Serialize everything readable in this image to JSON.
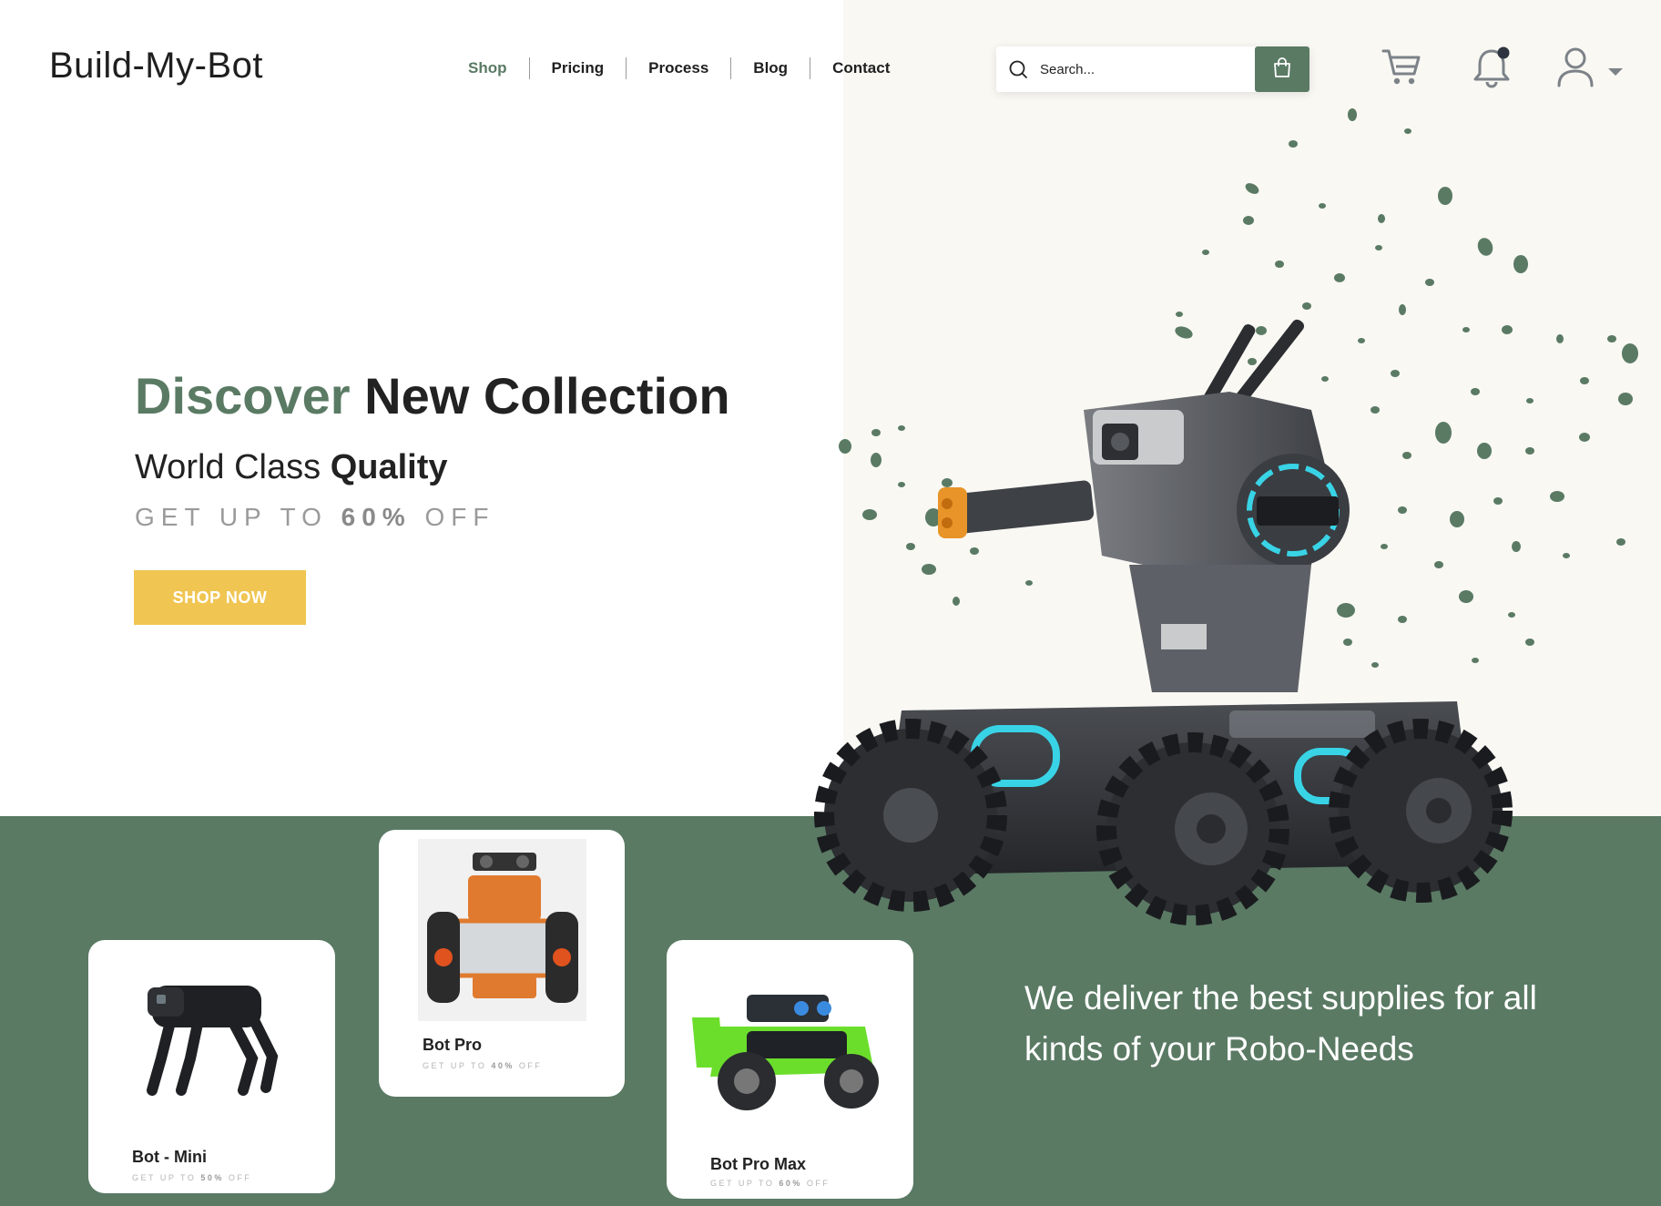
{
  "brand": {
    "logo_text": "Build-My-Bot"
  },
  "nav": {
    "items": [
      {
        "label": "Shop",
        "active": true
      },
      {
        "label": "Pricing"
      },
      {
        "label": "Process"
      },
      {
        "label": "Blog"
      },
      {
        "label": "Contact"
      }
    ]
  },
  "search": {
    "placeholder": "Search..."
  },
  "header_icons": [
    "shopping-bag-icon",
    "cart-icon",
    "bell-icon",
    "user-icon",
    "caret-down-icon"
  ],
  "hero": {
    "title_accent": "Discover",
    "title_rest": "New Collection",
    "subtitle_regular": "World Class",
    "subtitle_bold": "Quality",
    "offer_prefix": "GET UP TO",
    "offer_percent": "60%",
    "offer_suffix": "OFF",
    "cta_label": "SHOP NOW"
  },
  "products": [
    {
      "name": "Bot - Mini",
      "offer_prefix": "GET UP TO",
      "offer_percent": "50%",
      "offer_suffix": "OFF"
    },
    {
      "name": "Bot Pro",
      "offer_prefix": "GET UP TO",
      "offer_percent": "40%",
      "offer_suffix": "OFF"
    },
    {
      "name": "Bot Pro Max",
      "offer_prefix": "GET UP TO",
      "offer_percent": "60%",
      "offer_suffix": "OFF"
    }
  ],
  "tagline": "We deliver the best supplies for all kinds of your Robo-Needs",
  "colors": {
    "accent_green": "#5a7a64",
    "cta_yellow": "#f0c552",
    "panel_cream": "#f9f8f3",
    "text_dark": "#222222",
    "text_muted": "#9a9a9a",
    "robot_glow": "#39d3e6"
  }
}
